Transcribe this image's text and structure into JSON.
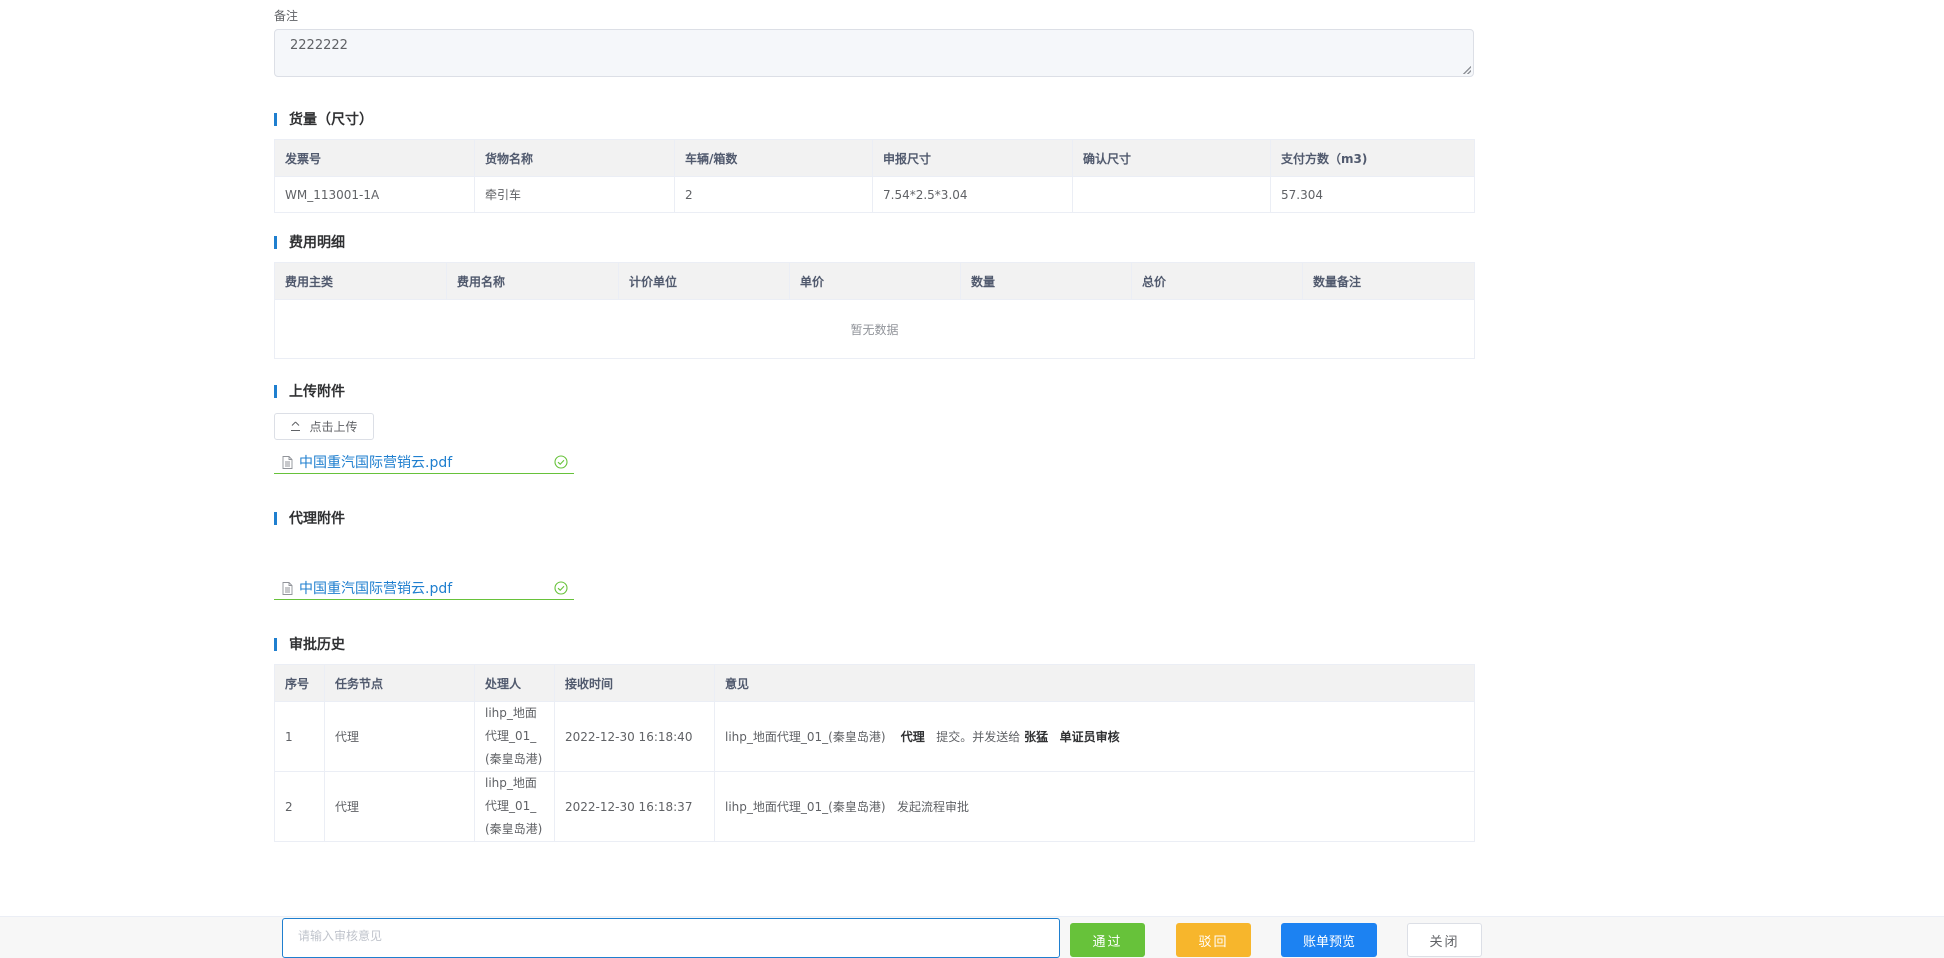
{
  "remark": {
    "label": "备注",
    "value": "2222222"
  },
  "cargo": {
    "title": "货量（尺寸）",
    "headers": [
      "发票号",
      "货物名称",
      "车辆/箱数",
      "申报尺寸",
      "确认尺寸",
      "支付方数（m3)"
    ],
    "rows": [
      [
        "WM_113001-1A",
        "牵引车",
        "2",
        "7.54*2.5*3.04",
        "",
        "57.304"
      ]
    ]
  },
  "fees": {
    "title": "费用明细",
    "headers": [
      "费用主类",
      "费用名称",
      "计价单位",
      "单价",
      "数量",
      "总价",
      "数量备注"
    ],
    "empty_text": "暂无数据"
  },
  "upload": {
    "title": "上传附件",
    "button_label": "点击上传",
    "file_name": "中国重汽国际营销云.pdf"
  },
  "agent": {
    "title": "代理附件",
    "file_name": "中国重汽国际营销云.pdf"
  },
  "approval": {
    "title": "审批历史",
    "headers": [
      "序号",
      "任务节点",
      "处理人",
      "接收时间",
      "意见"
    ],
    "rows": [
      {
        "no": "1",
        "node": "代理",
        "handler": "lihp_地面代理_01_(秦皇岛港)",
        "time": "2022-12-30 16:18:40",
        "opinion_prefix": "lihp_地面代理_01_(秦皇岛港)",
        "opinion_node": "代理",
        "opinion_mid": "提交。并发送给",
        "opinion_user": "张猛",
        "opinion_role": "单证员审核"
      },
      {
        "no": "2",
        "node": "代理",
        "handler": "lihp_地面代理_01_(秦皇岛港)",
        "time": "2022-12-30 16:18:37",
        "opinion_prefix": "lihp_地面代理_01_(秦皇岛港)",
        "opinion_text": "发起流程审批"
      }
    ]
  },
  "footer": {
    "review_placeholder": "请输入审核意见",
    "pass_label": "通过",
    "reject_label": "驳回",
    "preview_label": "账单预览",
    "close_label": "关闭"
  },
  "colors": {
    "accent": "#1f7fcf",
    "pass": "#67c23a",
    "reject": "#f7b62c",
    "preview": "#1c82f2"
  }
}
